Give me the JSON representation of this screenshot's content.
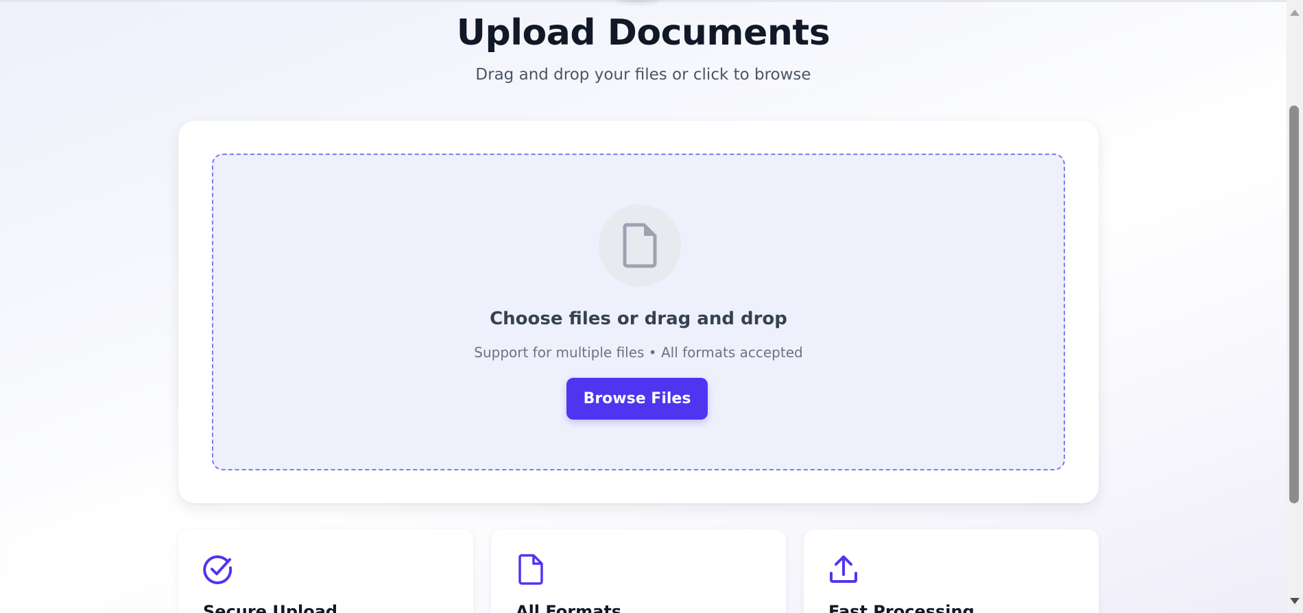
{
  "header": {
    "title": "Upload Documents",
    "subtitle": "Drag and drop your files or click to browse"
  },
  "dropzone": {
    "icon": "file-icon",
    "title": "Choose files or drag and drop",
    "support_text": "Support for multiple files • All formats accepted",
    "browse_label": "Browse Files"
  },
  "features": [
    {
      "icon": "check-circle-icon",
      "label": "Secure Upload"
    },
    {
      "icon": "file-icon",
      "label": "All Formats"
    },
    {
      "icon": "upload-icon",
      "label": "Fast Processing"
    }
  ],
  "colors": {
    "accent": "#4f35ef",
    "dropzone_border": "#7b7cf0",
    "dropzone_bg": "#eef1fc",
    "title": "#111827",
    "muted": "#6b7280"
  }
}
